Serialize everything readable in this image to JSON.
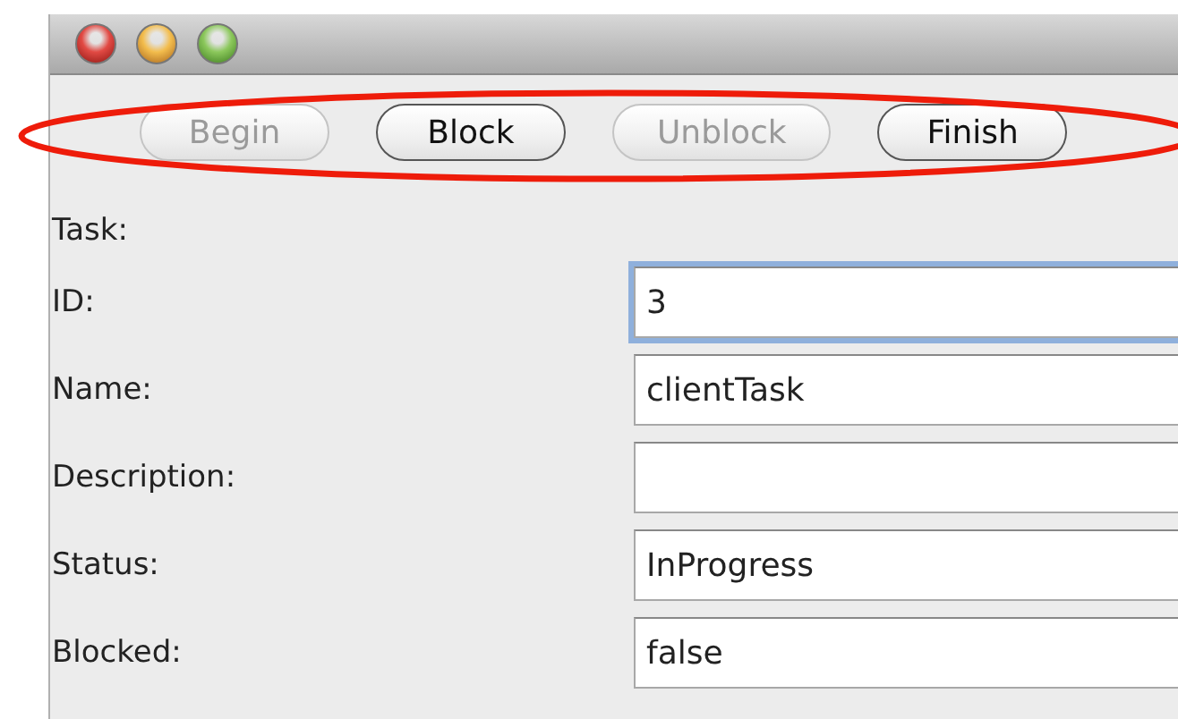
{
  "window": {
    "controls": [
      {
        "kind": "close"
      },
      {
        "kind": "minimize"
      },
      {
        "kind": "zoom"
      }
    ]
  },
  "toolbar": {
    "buttons": [
      {
        "label": "Begin",
        "disabled": true
      },
      {
        "label": "Block",
        "disabled": false
      },
      {
        "label": "Unblock",
        "disabled": true
      },
      {
        "label": "Finish",
        "disabled": false
      }
    ],
    "annotation": {
      "kind": "ellipse"
    }
  },
  "form": {
    "heading": "Task:",
    "fields": [
      {
        "label": "ID:",
        "value": "3",
        "focused": true
      },
      {
        "label": "Name:",
        "value": "clientTask",
        "focused": false
      },
      {
        "label": "Description:",
        "focused": false
      },
      {
        "label": "Status:",
        "value": "InProgress",
        "focused": false
      },
      {
        "label": "Blocked:",
        "value": "false",
        "focused": false
      }
    ]
  }
}
